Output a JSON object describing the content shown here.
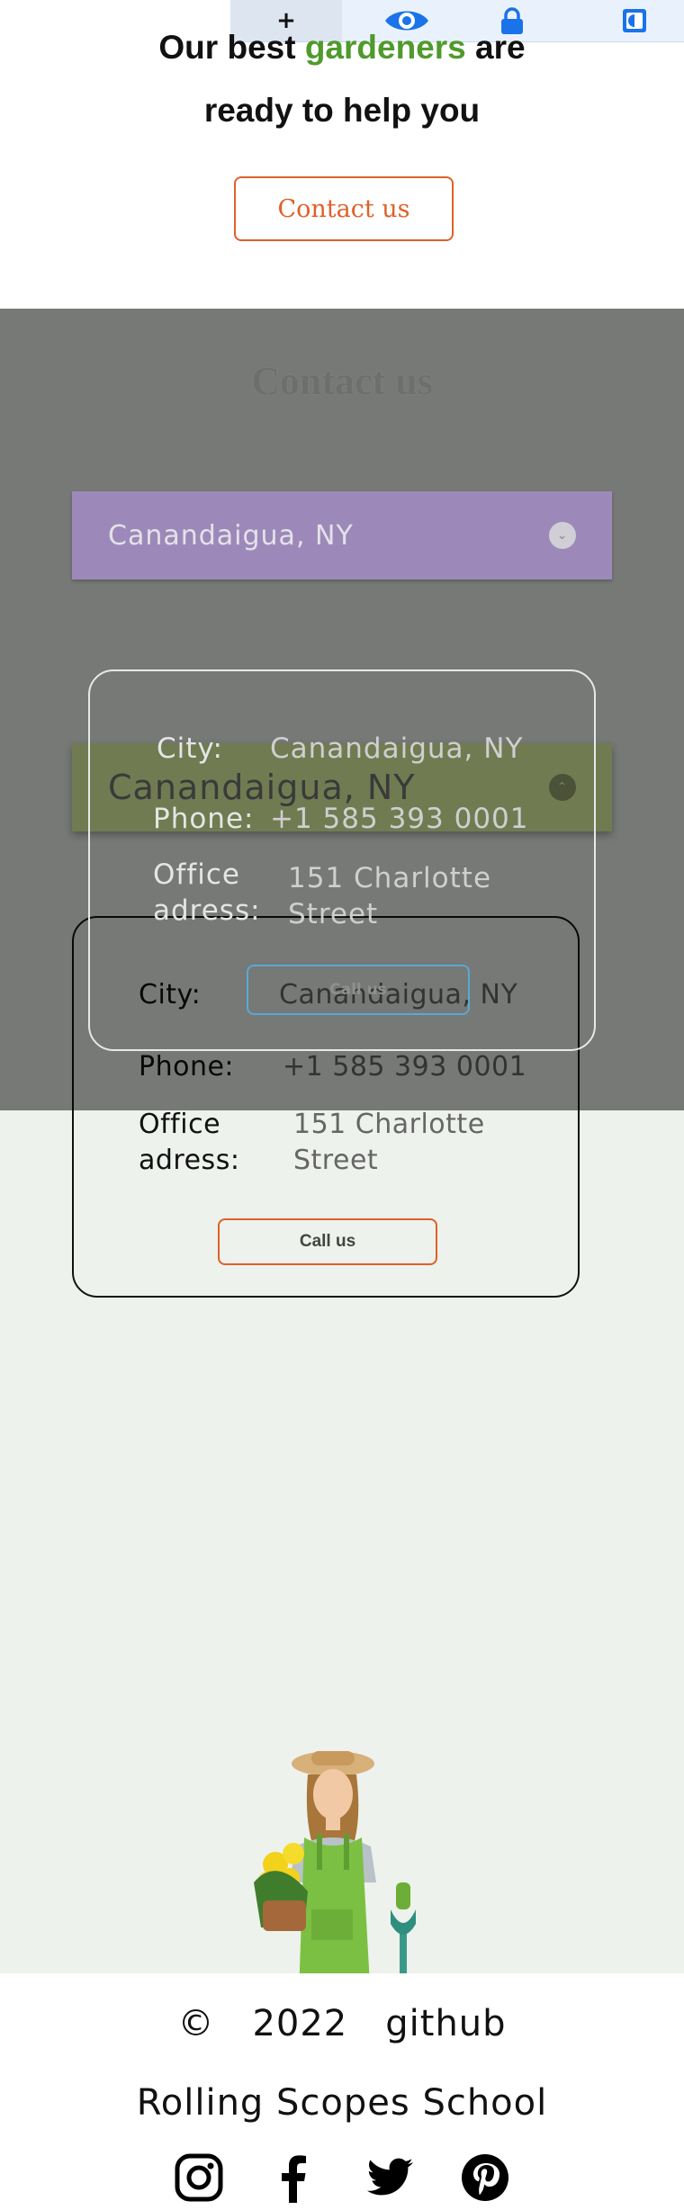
{
  "toolbar": {
    "add_label": "+",
    "icons": [
      "eye-icon",
      "lock-icon",
      "contrast-icon"
    ],
    "accent": "#1a73e8"
  },
  "hero": {
    "title_part1": "Our best ",
    "title_highlight": "gardeners",
    "title_part2": " are",
    "title_line2": "ready to help you",
    "contact_button": "Contact us",
    "highlight_color": "#4f9a2c",
    "button_color": "#e0602a"
  },
  "contact": {
    "heading": "Contact us",
    "select_value": "Canandaigua, NY",
    "open_select_value": "Canandaigua, NY",
    "overlay_card": {
      "city_label": "City:",
      "city_value": "Canandaigua, NY",
      "phone_label": "Phone:",
      "phone_value": "+1 585 393 0001",
      "office_label_1": "Office",
      "office_label_2": "adress:",
      "office_value_1": "151 Charlotte",
      "office_value_2": "Street",
      "call_button": "Call us"
    },
    "card": {
      "city_label": "City:",
      "city_value": "Canandaigua, NY",
      "phone_label": "Phone:",
      "phone_value": "+1 585 393 0001",
      "office_label_1": "Office",
      "office_label_2": "adress:",
      "office_value_1": "151 Charlotte",
      "office_value_2": "Street",
      "call_button": "Call us"
    }
  },
  "footer": {
    "copyright": "©",
    "year": "2022",
    "github": "github",
    "school": "Rolling Scopes School",
    "socials": [
      "instagram-icon",
      "facebook-icon",
      "twitter-icon",
      "pinterest-icon"
    ]
  }
}
